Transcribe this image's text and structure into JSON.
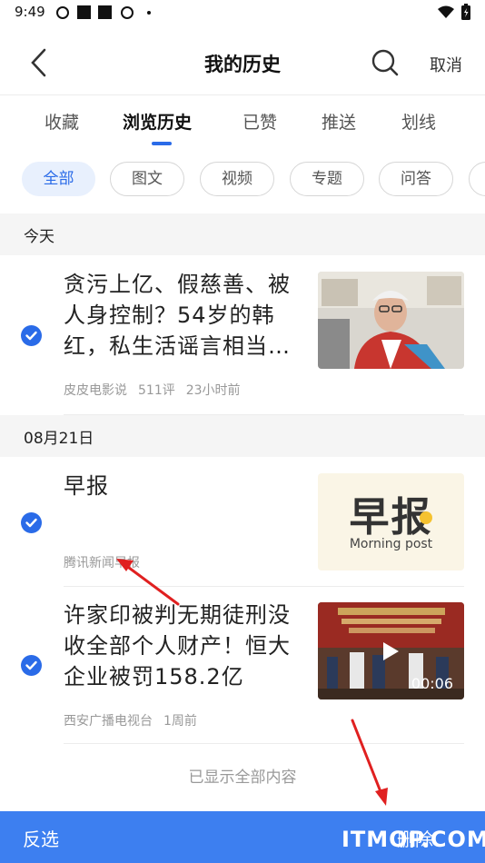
{
  "status": {
    "time": "9:49"
  },
  "nav": {
    "title": "我的历史",
    "cancel": "取消"
  },
  "tabs": [
    {
      "label": "收藏"
    },
    {
      "label": "浏览历史"
    },
    {
      "label": "已赞"
    },
    {
      "label": "推送"
    },
    {
      "label": "划线"
    }
  ],
  "filters": [
    {
      "label": "全部"
    },
    {
      "label": "图文"
    },
    {
      "label": "视频"
    },
    {
      "label": "专题"
    },
    {
      "label": "问答"
    }
  ],
  "sections": [
    {
      "label": "今天",
      "items": [
        {
          "title": "贪污上亿、假慈善、被人身控制？54岁的韩红，私生活谣言相当…",
          "source": "皮皮电影说",
          "comments": "511评",
          "time": "23小时前"
        }
      ]
    },
    {
      "label": "08月21日",
      "items": [
        {
          "title": "早报",
          "source": "腾讯新闻早报",
          "thumb_title": "早报",
          "thumb_subtitle": "Morning post"
        },
        {
          "title": "许家印被判无期徒刑没收全部个人财产！恒大企业被罚158.2亿",
          "source": "西安广播电视台",
          "time": "1周前",
          "duration": "00:06"
        }
      ]
    }
  ],
  "footer_note": "已显示全部内容",
  "bottom_bar": {
    "invert": "反选",
    "delete": "删除"
  },
  "watermark": "ITMOP.COM",
  "colors": {
    "accent": "#2a6be8",
    "bottom_bar": "#3d7ff0",
    "annotation_arrow": "#e02020"
  }
}
